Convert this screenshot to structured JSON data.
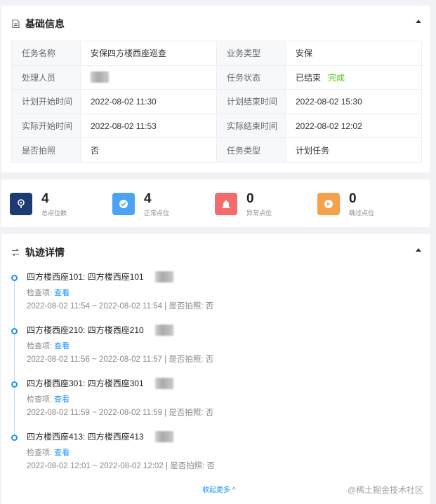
{
  "basic_info": {
    "title": "基础信息",
    "icon": "document-icon",
    "rows": [
      {
        "label1": "任务名称",
        "value1": "安保四方楼西座巡查",
        "label2": "业务类型",
        "value2": "安保"
      },
      {
        "label1": "处理人员",
        "value1": "",
        "label2": "任务状态",
        "value2": "已结束",
        "status_badge": "完成"
      },
      {
        "label1": "计划开始时间",
        "value1": "2022-08-02 11:30",
        "label2": "计划结束时间",
        "value2": "2022-08-02 15:30"
      },
      {
        "label1": "实际开始时间",
        "value1": "2022-08-02 11:53",
        "label2": "实际结束时间",
        "value2": "2022-08-02 12:02"
      },
      {
        "label1": "是否拍照",
        "value1": "否",
        "label2": "任务类型",
        "value2": "计划任务"
      }
    ]
  },
  "stats": [
    {
      "value": "4",
      "label": "总点位数",
      "color": "#1d3a73",
      "icon": "location-pin-icon"
    },
    {
      "value": "4",
      "label": "正常点位",
      "color": "#4da3f3",
      "icon": "check-circle-icon"
    },
    {
      "value": "0",
      "label": "异常点位",
      "color": "#f36b6b",
      "icon": "alarm-icon"
    },
    {
      "value": "0",
      "label": "跳过点位",
      "color": "#f5a04a",
      "icon": "skip-icon"
    }
  ],
  "track": {
    "title": "轨迹详情",
    "icon": "list-arrows-icon",
    "items": [
      {
        "title": "四方楼西座101: 四方楼西座101",
        "check_label": "检查项:",
        "check_link": "查看",
        "time": "2022-08-02 11:54 ~ 2022-08-02 11:54 | 是否拍照: 否"
      },
      {
        "title": "四方楼西座210: 四方楼西座210",
        "check_label": "检查项:",
        "check_link": "查看",
        "time": "2022-08-02 11:56 ~ 2022-08-02 11:57 | 是否拍照: 否"
      },
      {
        "title": "四方楼西座301: 四方楼西座301",
        "check_label": "检查项:",
        "check_link": "查看",
        "time": "2022-08-02 11:59 ~ 2022-08-02 11:59 | 是否拍照: 否"
      },
      {
        "title": "四方楼西座413: 四方楼西座413",
        "check_label": "检查项:",
        "check_link": "查看",
        "time": "2022-08-02 12:01 ~ 2022-08-02 12:02 | 是否拍照: 否"
      }
    ],
    "collapse_label": "收起更多 ^"
  },
  "watermark": "@稀土掘金技术社区",
  "colors": {
    "accent": "#1890ff",
    "success": "#52c41a"
  }
}
